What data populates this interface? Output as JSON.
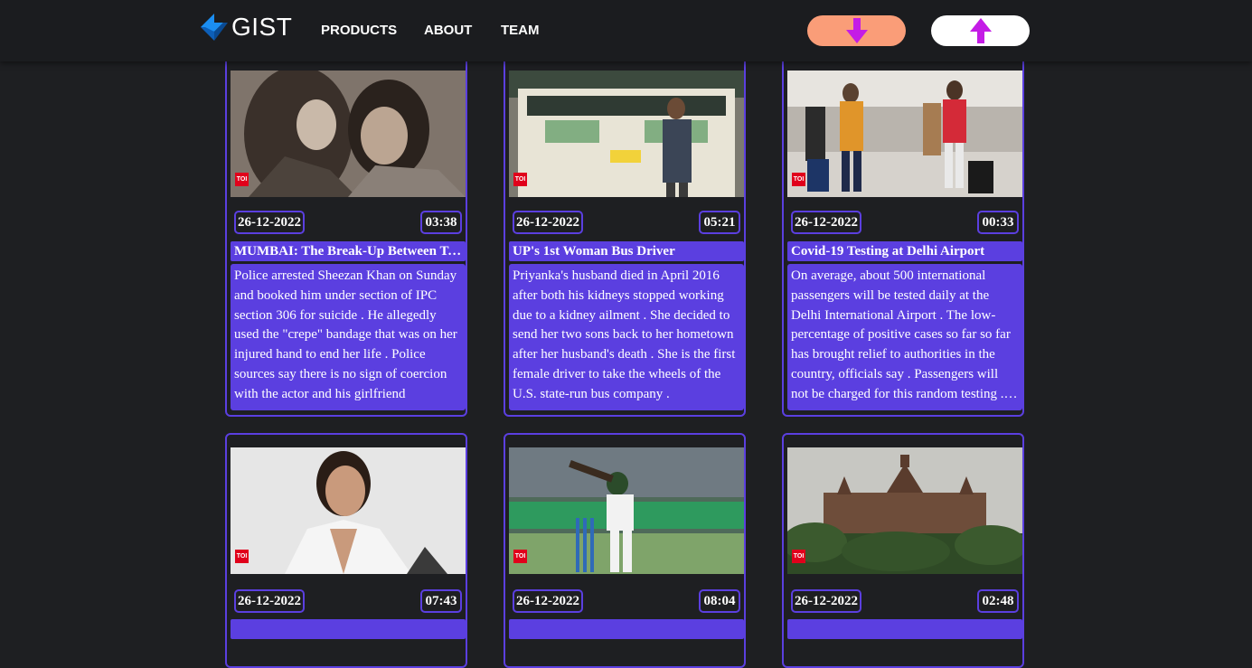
{
  "brand": {
    "name": "GIST"
  },
  "nav": {
    "products": "PRODUCTS",
    "about": "ABOUT",
    "team": "TEAM"
  },
  "actions": {
    "down_icon": "arrow-down-icon",
    "up_icon": "arrow-up-icon",
    "down_color": "#fa9d78",
    "up_color": "#ffffff",
    "arrow_color": "#c41ce6"
  },
  "cards": [
    {
      "date": "26-12-2022",
      "time": "03:38",
      "title": "MUMBAI: The Break-Up Between Tunisha Sharma And Sheezan Khan",
      "description": "Police arrested Sheezan Khan on Sunday and booked him under section of IPC section 306 for suicide . He allegedly used the \"crepe\" bandage that was on her injured hand to end her life . Police sources say there is no sign of coercion with the actor and his girlfriend",
      "source_badge": "TOI"
    },
    {
      "date": "26-12-2022",
      "time": "05:21",
      "title": "UP's 1st Woman Bus Driver",
      "description": "Priyanka's husband died in April 2016 after both his kidneys stopped working due to a kidney ailment . She decided to send her two sons back to her hometown after her husband's death . She is the first female driver to take the wheels of the U.S. state-run bus company .",
      "source_badge": "TOI"
    },
    {
      "date": "26-12-2022",
      "time": "00:33",
      "title": "Covid-19 Testing at Delhi Airport",
      "description": "On average, about 500 international passengers will be tested daily at the Delhi International Airport . The low-percentage of positive cases so far so far has brought relief to authorities in the country, officials say . Passengers will not be charged for this random testing . The cost of the testing will be borne by the government",
      "source_badge": "TOI"
    },
    {
      "date": "26-12-2022",
      "time": "07:43",
      "source_badge": "TOI"
    },
    {
      "date": "26-12-2022",
      "time": "08:04",
      "source_badge": "TOI"
    },
    {
      "date": "26-12-2022",
      "time": "02:48",
      "source_badge": "TOI"
    }
  ],
  "colors": {
    "accent": "#5b3fe0",
    "background": "#1e1f22",
    "navbar": "#1b1c1f",
    "logo_blue": "#1b8ef2"
  }
}
